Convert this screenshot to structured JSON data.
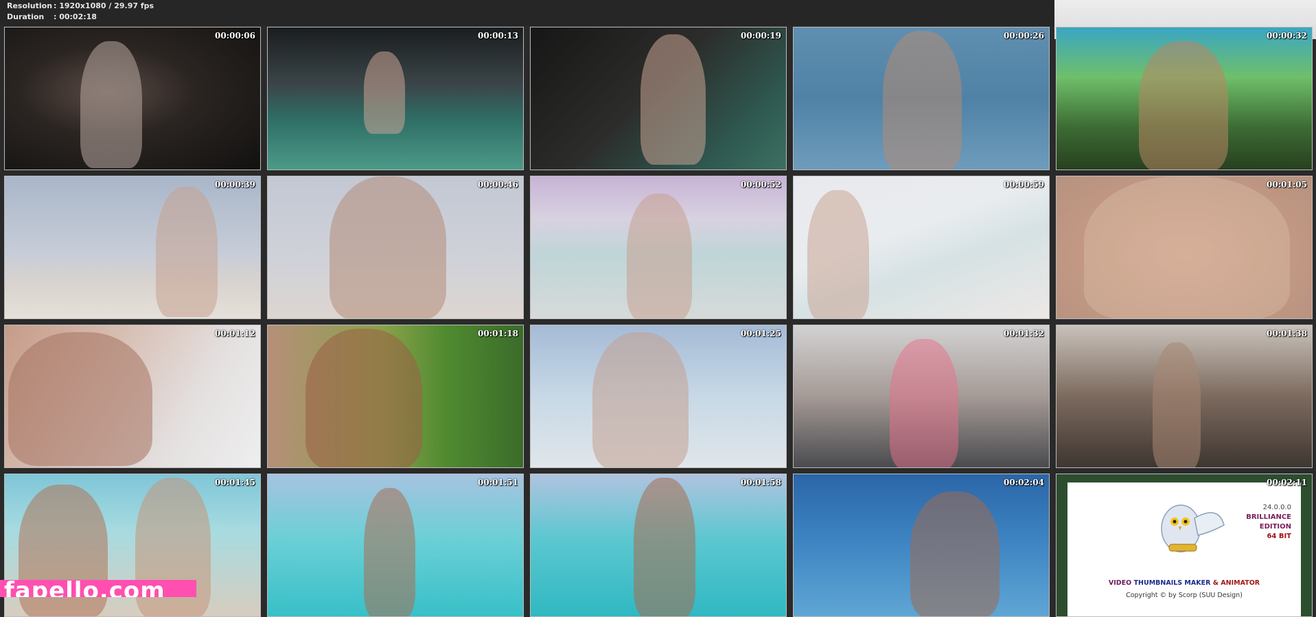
{
  "info": {
    "resolution_label": "Resolution",
    "resolution_value": ": 1920x1080 / 29.97 fps",
    "duration_label": "Duration",
    "duration_value": ": 00:02:18"
  },
  "thumbnails": [
    {
      "time": "00:00:06",
      "scene": "dark-foliage"
    },
    {
      "time": "00:00:13",
      "scene": "night-pool"
    },
    {
      "time": "00:00:19",
      "scene": "night-pool-close"
    },
    {
      "time": "00:00:26",
      "scene": "sea-swimsuit"
    },
    {
      "time": "00:00:32",
      "scene": "interview-garden"
    },
    {
      "time": "00:00:39",
      "scene": "beach-side"
    },
    {
      "time": "00:00:46",
      "scene": "beach-closeup"
    },
    {
      "time": "00:00:52",
      "scene": "beach-standing"
    },
    {
      "time": "00:00:59",
      "scene": "shoreline-walk"
    },
    {
      "time": "00:01:05",
      "scene": "raincoat-closeup"
    },
    {
      "time": "00:01:12",
      "scene": "surf-crouch"
    },
    {
      "time": "00:01:18",
      "scene": "sunglasses-greenery"
    },
    {
      "time": "00:01:25",
      "scene": "beach-raincoat"
    },
    {
      "time": "00:01:32",
      "scene": "fitting-room"
    },
    {
      "time": "00:01:38",
      "scene": "fitting-room-wide"
    },
    {
      "time": "00:01:45",
      "scene": "beach-couple"
    },
    {
      "time": "00:01:51",
      "scene": "turquoise-sea-board"
    },
    {
      "time": "00:01:58",
      "scene": "turquoise-sea-board-2"
    },
    {
      "time": "00:02:04",
      "scene": "blue-sea-portrait"
    },
    {
      "time": "00:02:11",
      "scene": "app-logo"
    }
  ],
  "logo": {
    "version": "24.0.0.0",
    "edition_line1": "BRILLIANCE",
    "edition_line2": "EDITION",
    "bits": "64 BIT",
    "title_part1": "VIDEO",
    "title_part2": "THUMBNAILS MAKER",
    "title_part3": "& ANIMATOR",
    "copyright": "Copyright © by Scorp (SUU Design)"
  },
  "watermark": {
    "text": "fapello.com"
  },
  "colors": {
    "background": "#2a2a2a",
    "watermark": "#ff4fb0",
    "border": "#bdbdbd"
  }
}
